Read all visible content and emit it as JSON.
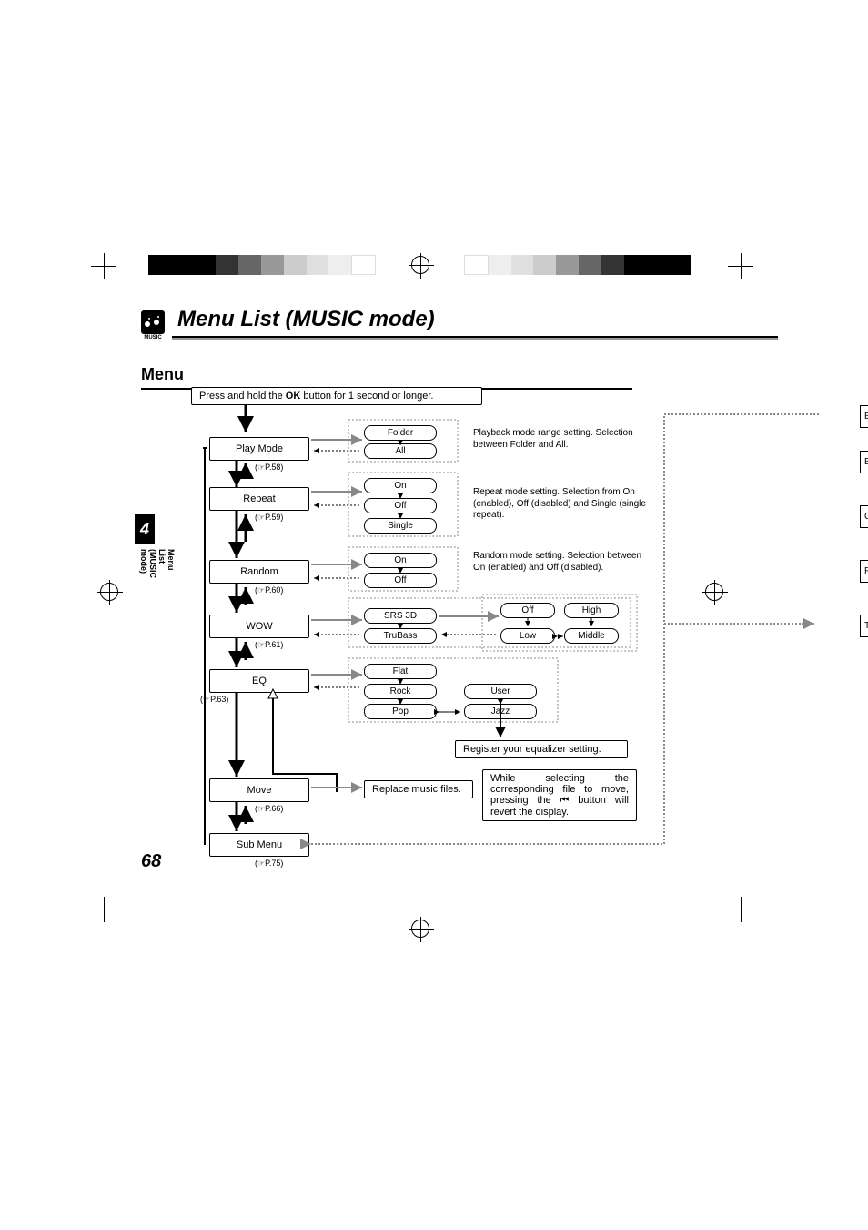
{
  "header": {
    "icon_label": "MUSIC",
    "title": "Menu List (MUSIC mode)",
    "subtitle": "Menu"
  },
  "sidebar": {
    "chapter": "4",
    "label": "Menu List (MUSIC mode)",
    "page_number": "68"
  },
  "instruction": {
    "prefix": "Press and hold the ",
    "bold": "OK",
    "suffix": " button for 1 second or longer."
  },
  "menu": {
    "play_mode": {
      "label": "Play Mode",
      "ref": "(☞P.58)",
      "opts": [
        "Folder",
        "All"
      ],
      "desc": "Playback mode range setting. Selection between Folder and All."
    },
    "repeat": {
      "label": "Repeat",
      "ref": "(☞P.59)",
      "opts": [
        "On",
        "Off",
        "Single"
      ],
      "desc": "Repeat mode setting. Selection from On (enabled), Off (disabled) and Single (single repeat)."
    },
    "random": {
      "label": "Random",
      "ref": "(☞P.60)",
      "opts": [
        "On",
        "Off"
      ],
      "desc": "Random mode setting. Selection between On (enabled) and Off (disabled)."
    },
    "wow": {
      "label": "WOW",
      "ref": "(☞P.61)",
      "opts": [
        "SRS 3D",
        "TruBass"
      ],
      "levels": [
        "Off",
        "High",
        "Low",
        "Middle"
      ]
    },
    "eq": {
      "label": "EQ",
      "ref": "(☞P.63)",
      "opts": [
        "Flat",
        "Rock",
        "Pop",
        "User",
        "Jazz"
      ],
      "note": "Register your equalizer setting."
    },
    "move": {
      "label": "Move",
      "ref": "(☞P.66)",
      "note": "Replace music files.",
      "desc_pre": "While selecting the corresponding file to move, pressing the ",
      "desc_post": " button will revert the display."
    },
    "submenu": {
      "label": "Sub Menu",
      "ref": "(☞P.75)"
    }
  },
  "cutoff": {
    "a": "B",
    "b": "Bac",
    "c": "Co",
    "d": "Fo",
    "e": "Time"
  }
}
